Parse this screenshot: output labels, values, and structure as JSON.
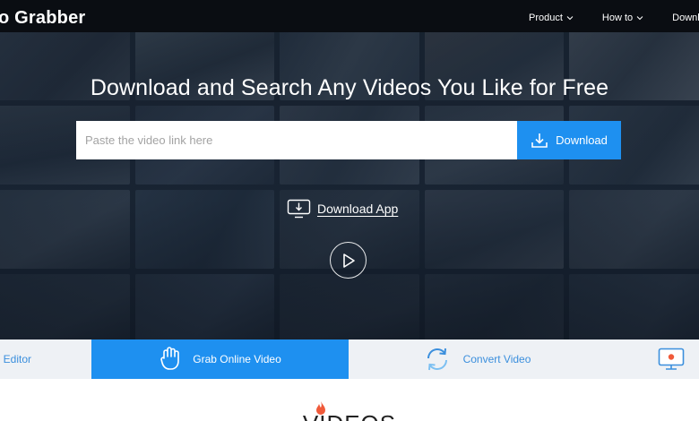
{
  "header": {
    "brand": "o Grabber",
    "nav": [
      {
        "label": "Product"
      },
      {
        "label": "How to"
      },
      {
        "label": "Downl"
      }
    ]
  },
  "hero": {
    "title": "Download and Search Any Videos You Like for Free",
    "search": {
      "placeholder": "Paste the video link here",
      "value": ""
    },
    "download_button": "Download",
    "download_app": "Download App"
  },
  "tabs": [
    {
      "label": "eo Editor"
    },
    {
      "label": "Grab Online Video",
      "active": true
    },
    {
      "label": "Convert Video"
    },
    {
      "label": ""
    }
  ],
  "section": {
    "title": "VIDEOS"
  },
  "colors": {
    "accent": "#1e90f0",
    "header_bg": "#0a0d12",
    "tab_bar_bg": "#eef1f5",
    "tab_text": "#3b8fdd",
    "flame": "#f05a3a"
  }
}
